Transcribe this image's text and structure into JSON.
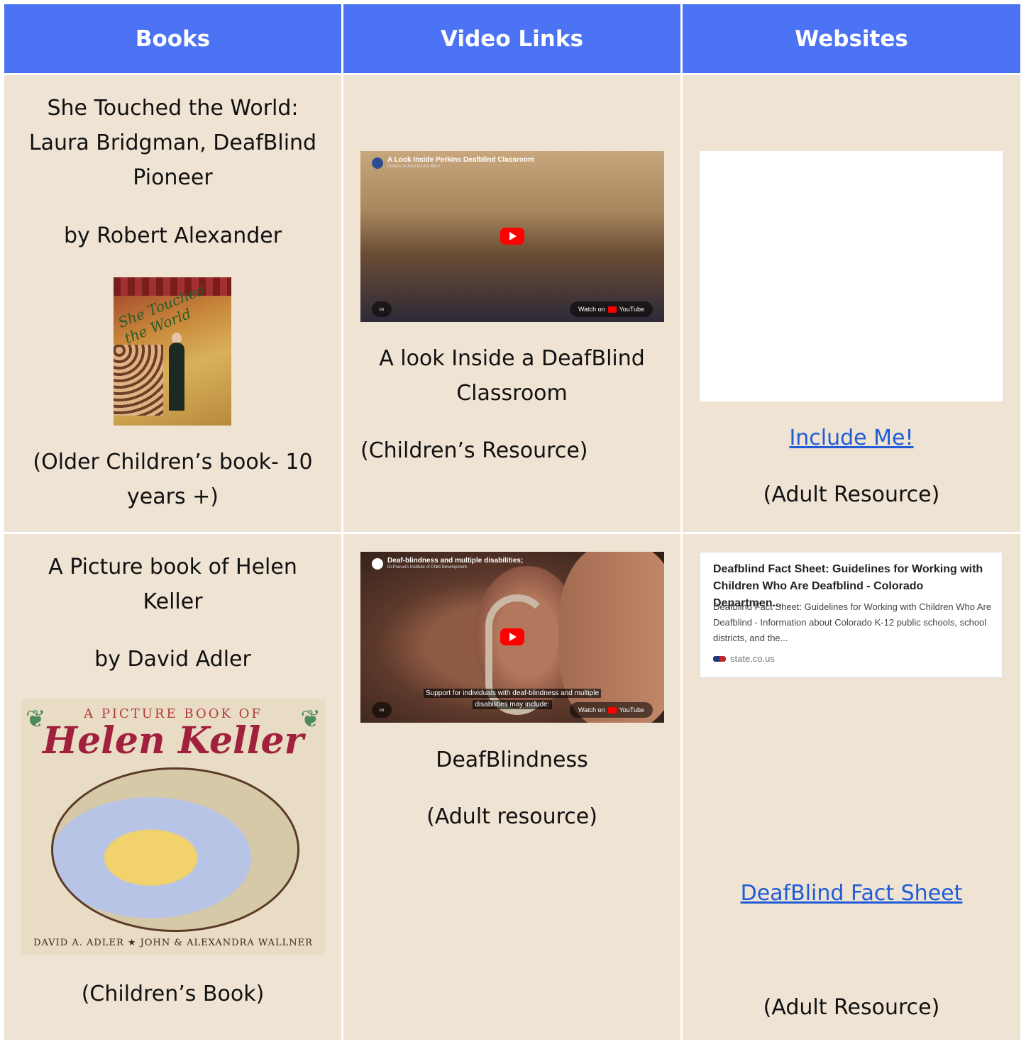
{
  "headers": [
    "Books",
    "Video Links",
    "Websites"
  ],
  "row1": {
    "book": {
      "title_line1": "She Touched the World:",
      "title_line2": "Laura Bridgman, DeafBlind",
      "title_line3": "Pioneer",
      "author": "by Robert Alexander",
      "cover_title": "She Touched the World",
      "note_line1": "(Older Children’s book- 10",
      "note_line2": "years +)"
    },
    "video": {
      "channel_title": "A Look Inside Perkins Deafblind Classroom",
      "channel_sub": "Perkins School for the Blind",
      "watch_label": "Watch on",
      "yt_label": "YouTube",
      "label_line1": "A look Inside a DeafBlind",
      "label_line2": "Classroom",
      "note": "(Children’s Resource)"
    },
    "website": {
      "link": "Include Me!",
      "note": "(Adult Resource)"
    }
  },
  "row2": {
    "book": {
      "title_line1": "A Picture book of Helen",
      "title_line2": "Keller",
      "author": "by David Adler",
      "cover_pre": "A PICTURE BOOK OF",
      "cover_name": "Helen Keller",
      "cover_authors": "DAVID A. ADLER ★ JOHN & ALEXANDRA WALLNER",
      "note": "(Children’s Book)"
    },
    "video": {
      "channel_title": "Deaf-blindness and multiple disabilities;",
      "channel_sub": "Dr.Poovai's Institute of Child Development",
      "caption_line1": "Support for individuals with deaf-blindness and multiple",
      "caption_line2": "disabilities may include:",
      "watch_label": "Watch on",
      "yt_label": "YouTube",
      "label": "DeafBlindness",
      "note": "(Adult resource)"
    },
    "website": {
      "card_title": "Deafblind Fact Sheet: Guidelines for Working with Children Who Are Deafblind - Colorado Departmen...",
      "card_desc": "Deafblind Fact Sheet: Guidelines for Working with Children Who Are Deafblind - Information about Colorado K-12 public schools, school districts, and the...",
      "card_source": "state.co.us",
      "link": "DeafBlind Fact Sheet",
      "note": "(Adult Resource)"
    }
  },
  "colors": {
    "header": "#4b73f3",
    "cell": "#efe3d4",
    "link": "#1f5cd6"
  }
}
